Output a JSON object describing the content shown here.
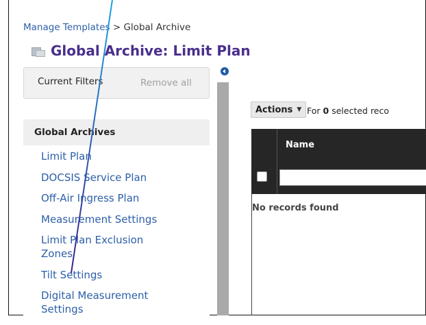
{
  "breadcrumb": {
    "parent": "Manage Templates",
    "separator": " > ",
    "current": "Global Archive"
  },
  "page": {
    "title": "Global Archive: Limit Plan",
    "title_color": "#4a2f8c"
  },
  "filters": {
    "label": "Current Filters",
    "remove_all": "Remove all"
  },
  "archives": {
    "header": "Global Archives",
    "items": [
      {
        "label": "Limit Plan"
      },
      {
        "label": "DOCSIS Service Plan"
      },
      {
        "label": "Off-Air Ingress Plan"
      },
      {
        "label": "Measurement Settings"
      },
      {
        "label": "Limit Plan Exclusion Zones"
      },
      {
        "label": "Tilt Settings"
      },
      {
        "label": "Digital Measurement Settings"
      }
    ]
  },
  "actions": {
    "button_label": "Actions",
    "for_prefix": "For",
    "selected_count": "0",
    "selected_suffix": "selected reco"
  },
  "grid": {
    "columns": [
      "Name"
    ],
    "filter_value": "",
    "empty_message": "No records found"
  },
  "colors": {
    "link": "#2c5fa8",
    "grid_header": "#262626",
    "annotation_line_start": "#1aa3e8",
    "annotation_line_end": "#3a1f8a"
  }
}
